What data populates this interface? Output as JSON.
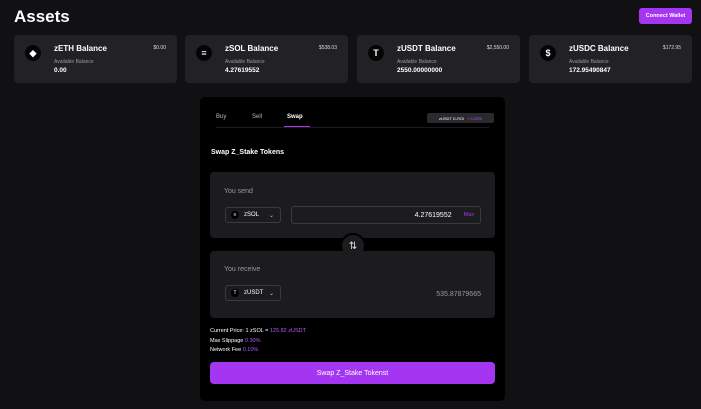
{
  "header": {
    "title": "Assets",
    "connect_label": "Connect Wallet"
  },
  "cards": [
    {
      "name": "zETH Balance",
      "usd": "$0.00",
      "sub": "Available Balance",
      "balance": "0.00",
      "icon": "ethereum-icon"
    },
    {
      "name": "zSOL Balance",
      "usd": "$538.03",
      "sub": "Available Balance",
      "balance": "4.27619552",
      "icon": "solana-icon"
    },
    {
      "name": "zUSDT Balance",
      "usd": "$2,550.00",
      "sub": "Available Balance",
      "balance": "2550.00000000",
      "icon": "tether-icon"
    },
    {
      "name": "zUSDC Balance",
      "usd": "$172.95",
      "sub": "Available Balance",
      "balance": "172.95490847",
      "icon": "usdc-icon"
    }
  ],
  "swap": {
    "tabs": [
      "Buy",
      "Sell",
      "Swap"
    ],
    "active_tab": "Swap",
    "ticker_label": "zUSDT D-ROI",
    "ticker_change": "+ 0.25%",
    "section_title": "Swap Z_Stake Tokens",
    "send": {
      "label": "You send",
      "token": "zSOL",
      "amount": "4.27619552",
      "max_label": "Max"
    },
    "receive": {
      "label": "You receive",
      "token": "zUSDT",
      "amount": "535.87879665"
    },
    "price_prefix": "Current Price: 1 zSOL = ",
    "price_value": "125.82 zUSDT",
    "slippage_prefix": "Max Slippage ",
    "slippage_value": "0.30%",
    "fee_prefix": "Network Fee ",
    "fee_value": "0.10%",
    "button_label": "Swap Z_Stake Tokenst"
  },
  "colors": {
    "accent": "#a435f0",
    "background": "#111113",
    "card": "#222226",
    "panel": "#000000"
  }
}
